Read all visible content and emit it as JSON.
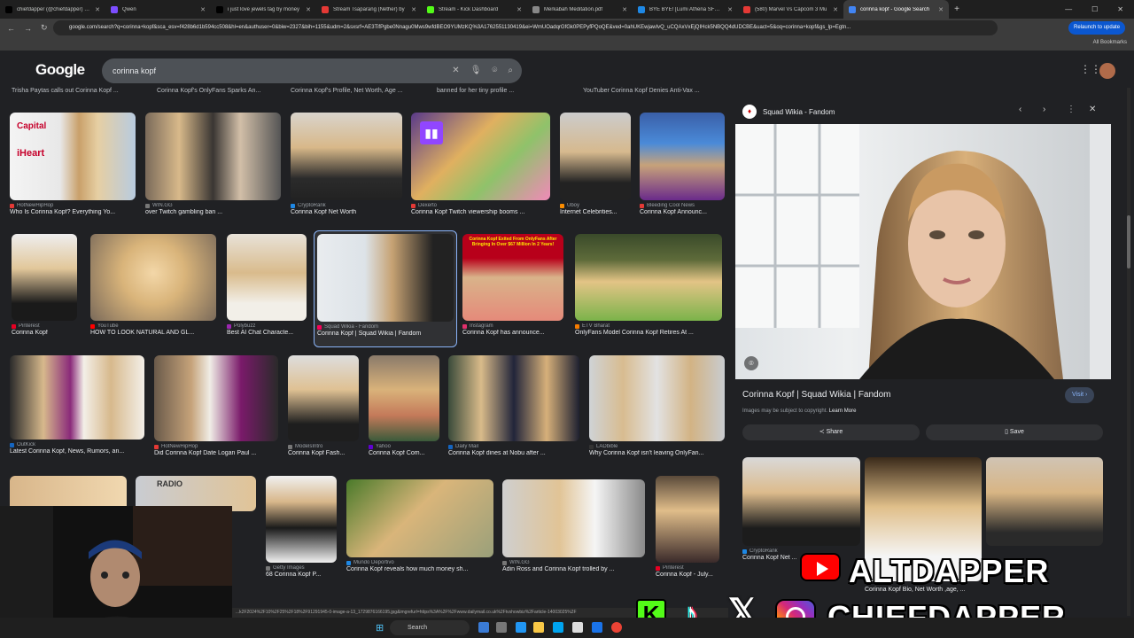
{
  "browser": {
    "tabs": [
      {
        "title": "chiefdapper (@chiefdapper) / X",
        "color": "#000000"
      },
      {
        "title": "Qwen",
        "color": "#7c4dff"
      },
      {
        "title": "i just love jewels tag by money",
        "color": "#000000"
      },
      {
        "title": "Stream Tsaparang (Nether) by",
        "color": "#e53935"
      },
      {
        "title": "Stream - Kick Dashboard",
        "color": "#53fc18"
      },
      {
        "title": "Merkabah Meditation.pdf",
        "color": "#888888"
      },
      {
        "title": "BYE BYE! [Lumi Athena SFX] by",
        "color": "#1e88e5"
      },
      {
        "title": "(580) Marvel Vs Capcom 3 Mu",
        "color": "#e53935"
      },
      {
        "title": "corinna kopf - Google Search",
        "color": "#4285f4",
        "active": true
      }
    ],
    "new_tab": "+",
    "url": "google.com/search?q=corinna+kopf&sca_esv=f428b6d1b594cc508&hl=en&authuser=0&biw=2327&bih=1155&udm=2&sxsrf=AE3TifPgbe0Nnagu0Mws9wfdBEO9YUMzKQ%3A1762551130419&ei=WmUOadqrGfGk0PEPyfPQoQE&ved=0ahUKEwjawIvQ_uCQAxVxEjQIHck5NBQQ4dUDCBE&uact=5&oq=corinna+kopf&gs_lp=Egtn...",
    "relaunch": "Relaunch to update",
    "all_bookmarks": "All Bookmarks"
  },
  "google": {
    "logo": "Google",
    "query": "corinna kopf"
  },
  "top_row": [
    "Trisha Paytas calls out Corinna Kopf ...",
    "Corinna Kopf's OnlyFans Sparks An...",
    "Corinna Kopf's Profile, Net Worth, Age ...",
    "banned for her tiny profile ...",
    "YouTuber Corinna Kopf Denies Anti-Vax ..."
  ],
  "rows": [
    [
      {
        "src": "HotNewHipHop",
        "title": "Who Is Corinna Kopf? Everything Yo...",
        "c": "#e53935"
      },
      {
        "src": "WIN.GG",
        "title": "over Twitch gambling ban ...",
        "c": "#777"
      },
      {
        "src": "CryptoRank",
        "title": "Corinna Kopf Net Worth",
        "c": "#1e88e5"
      },
      {
        "src": "Dexerto",
        "title": "Corinna Kopf Twitch viewership booms ...",
        "c": "#e53935"
      },
      {
        "src": "Uboy",
        "title": "Internet Celebrities...",
        "c": "#fb8c00"
      },
      {
        "src": "Bleeding Cool News",
        "title": "Corinna Kopf Announc...",
        "c": "#e53935"
      }
    ],
    [
      {
        "src": "Pinterest",
        "title": "Corinna Kopf",
        "c": "#e60023"
      },
      {
        "src": "YouTube",
        "title": "HOW TO LOOK NATURAL AND GL...",
        "c": "#ff0000"
      },
      {
        "src": "Polybuzz",
        "title": "Best AI Chat Characte...",
        "c": "#9c27b0"
      },
      {
        "src": "Squad Wikia - Fandom",
        "title": "Corinna Kopf | Squad Wikia | Fandom",
        "c": "#fa005a"
      },
      {
        "src": "Instagram",
        "title": "Corinna Kopf has announce...",
        "c": "#e1306c"
      },
      {
        "src": "ETV Bharat",
        "title": "OnlyFans Model Corinna Kopf Retires At ...",
        "c": "#f57c00"
      }
    ],
    [
      {
        "src": "OutKick",
        "title": "Latest Corinna Kopf, News, Rumors, an...",
        "c": "#1565c0"
      },
      {
        "src": "HotNewHipHop",
        "title": "Did Corinna Kopf Date Logan Paul ...",
        "c": "#e53935"
      },
      {
        "src": "ModelsIntro",
        "title": "Corinna Kopf Fash...",
        "c": "#777"
      },
      {
        "src": "Yahoo",
        "title": "Corinna Kopf Com...",
        "c": "#6001d2"
      },
      {
        "src": "Daily Mail",
        "title": "Corinna Kopf dines at Nobu after ...",
        "c": "#1565c0"
      },
      {
        "src": "LADbible",
        "title": "Why Corinna Kopf isn't leaving OnlyFan...",
        "c": "#333"
      }
    ],
    [
      {
        "src": "Getty Images",
        "title": "68 Corinna Kopf P...",
        "c": "#777"
      },
      {
        "src": "Mundo Deportivo",
        "title": "Corinna Kopf reveals how much money sh...",
        "c": "#1e88e5"
      },
      {
        "src": "WIN.GG",
        "title": "Adin Ross and Corinna Kopf trolled by ...",
        "c": "#777"
      },
      {
        "src": "Pinterest",
        "title": "Corinna Kopf - July...",
        "c": "#e60023"
      }
    ]
  ],
  "thumb_text": {
    "iheart": "iHeart",
    "capital": "Capital",
    "headline": "Corinna Kopf Exited From OnlyFans After Bringing In Over $67 Million In 2 Years!",
    "radio": "RADIO"
  },
  "panel": {
    "source": "Squad Wikia - Fandom",
    "title": "Corinna Kopf | Squad Wikia | Fandom",
    "visit": "Visit ›",
    "note": "Images may be subject to copyright.",
    "learn_more": "Learn More",
    "share": "Share",
    "save": "Save",
    "related": [
      {
        "src": "CryptoRank",
        "title": "Corinna Kopf Net ..."
      },
      {
        "src": "",
        "title": "Corinna Kopf Bio, Net Worth ,age, ..."
      }
    ]
  },
  "overlay": {
    "line1": "ALTDAPPER",
    "line2": "CHIEFDAPPER",
    "kick": "K"
  },
  "taskbar": {
    "search": "Search"
  },
  "status_url": "...k2F2024%2F10%2F25%2F18%2F91291945-0-image-a-13_1729876166195.jpg&imgrefurl=https%3A%2F%2Fwww.dailymail.co.uk%2Ftvshowbiz%2Farticle-14003025%2F"
}
